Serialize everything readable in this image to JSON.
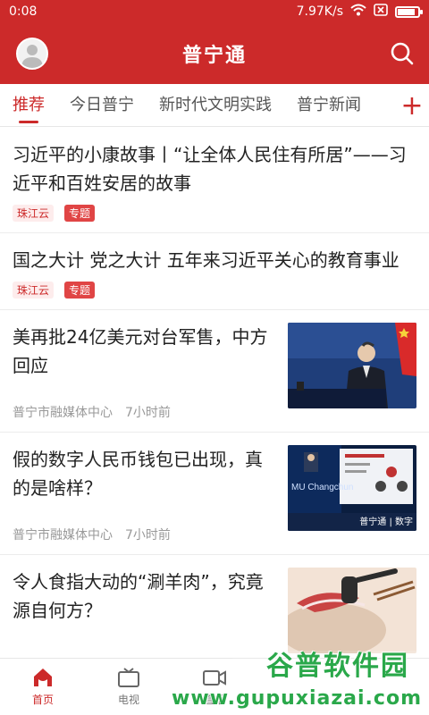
{
  "status": {
    "time": "0:08",
    "speed": "7.97K/s",
    "battery_level": 0.8
  },
  "app": {
    "title": "普宁通"
  },
  "colors": {
    "brand": "#cc2a2a",
    "tag_bg": "#fdecec",
    "tag_topic": "#e04545"
  },
  "tabs": [
    {
      "label": "推荐",
      "active": true
    },
    {
      "label": "今日普宁"
    },
    {
      "label": "新时代文明实践"
    },
    {
      "label": "普宁新闻"
    }
  ],
  "tab_add_icon": "plus-icon",
  "feed": {
    "items": [
      {
        "title": "习近平的小康故事丨“让全体人民住有所居”——习近平和百姓安居的故事",
        "source_tag": "珠江云",
        "topic_tag": "专题"
      },
      {
        "title": "国之大计 党之大计 五年来习近平关心的教育事业",
        "source_tag": "珠江云",
        "topic_tag": "专题"
      },
      {
        "title": "美再批24亿美元对台军售，中方回应",
        "source": "普宁市融媒体中心",
        "time": "7小时前",
        "thumb_text": ""
      },
      {
        "title": "假的数字人民币钱包已出现，真的是啥样？",
        "source": "普宁市融媒体中心",
        "time": "7小时前",
        "thumb_caption": "MU Changchun",
        "thumb_footer": "普宁通 | 数字"
      },
      {
        "title": "令人食指大动的“涮羊肉”，究竟源自何方？"
      }
    ]
  },
  "bottom_nav": [
    {
      "label": "首页",
      "icon": "home-icon",
      "active": true
    },
    {
      "label": "电视",
      "icon": "tv-icon"
    },
    {
      "label": "直播",
      "icon": "video-icon"
    }
  ],
  "watermark": {
    "line1": "谷普软件园",
    "line2": "www.gupuxiazai.com"
  }
}
